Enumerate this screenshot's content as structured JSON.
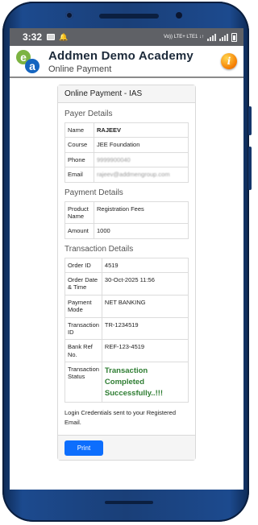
{
  "status_bar": {
    "time": "3:32",
    "network_label": "Vo)) LTE+ LTE1 ↓↑",
    "icons": [
      "message-icon",
      "notification-bell-icon",
      "signal-icon",
      "battery-icon"
    ]
  },
  "app": {
    "logo_letters": [
      "e",
      "a"
    ],
    "title": "Addmen Demo Academy",
    "subtitle": "Online Payment",
    "info_icon": "i"
  },
  "card": {
    "header": "Online Payment - IAS",
    "payer_section": {
      "title": "Payer Details",
      "rows": [
        {
          "label": "Name",
          "value": "RAJEEV"
        },
        {
          "label": "Course",
          "value": "JEE Foundation"
        },
        {
          "label": "Phone",
          "value": "9999900040"
        },
        {
          "label": "Email",
          "value": "rajeev@addmengroup.com"
        }
      ]
    },
    "payment_section": {
      "title": "Payment Details",
      "rows": [
        {
          "label": "Product Name",
          "value": "Registration Fees"
        },
        {
          "label": "Amount",
          "value": "1000"
        }
      ]
    },
    "transaction_section": {
      "title": "Transaction Details",
      "rows": [
        {
          "label": "Order ID",
          "value": "4519"
        },
        {
          "label": "Order Date & Time",
          "value": "30-Oct-2025 11:56"
        },
        {
          "label": "Payment Mode",
          "value": "NET BANKING"
        },
        {
          "label": "Transaction ID",
          "value": "TR-1234519"
        },
        {
          "label": "Bank Ref No.",
          "value": "REF-123-4519"
        },
        {
          "label": "Transaction Status",
          "value": "Transaction Completed Successfully..!!!"
        }
      ]
    },
    "note": "Login Credentials sent to your Registered Email.",
    "print_label": "Print"
  },
  "colors": {
    "status_bar": "#5f6166",
    "success_text": "#2e7d32",
    "print_button": "#0d6efd",
    "phone_frame": "#1a3f78"
  }
}
